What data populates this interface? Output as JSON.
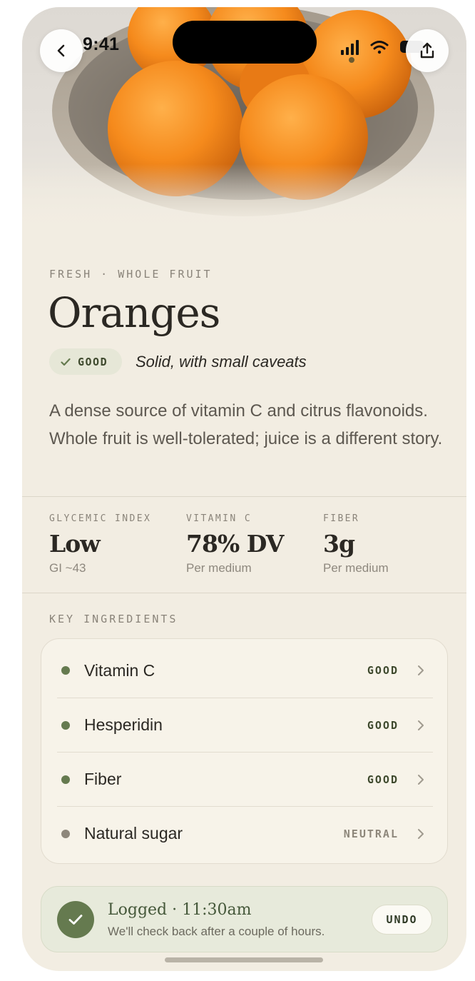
{
  "status_bar": {
    "time": "9:41"
  },
  "hero": {
    "image": "bowl of oranges photo"
  },
  "header": {
    "back_icon": "chevron-left-icon",
    "share_icon": "share-icon"
  },
  "food": {
    "eyebrow": "FRESH · WHOLE FRUIT",
    "name": "Oranges",
    "rating_label": "GOOD",
    "verdict": "Solid, with small caveats",
    "description": "A dense source of vitamin C and citrus flavonoids. Whole fruit is well-tolerated; juice is a different story."
  },
  "stats": [
    {
      "label": "GLYCEMIC INDEX",
      "value": "Low",
      "sub": "GI ~43"
    },
    {
      "label": "VITAMIN C",
      "value": "78% DV",
      "sub": "Per medium"
    },
    {
      "label": "FIBER",
      "value": "3g",
      "sub": "Per medium"
    }
  ],
  "ingredients": {
    "section_label": "KEY INGREDIENTS",
    "items": [
      {
        "name": "Vitamin C",
        "rating": "GOOD"
      },
      {
        "name": "Hesperidin",
        "rating": "GOOD"
      },
      {
        "name": "Fiber",
        "rating": "GOOD"
      },
      {
        "name": "Natural sugar",
        "rating": "NEUTRAL"
      }
    ]
  },
  "logged": {
    "title": "Logged · 11:30am",
    "subtitle": "We'll check back after a couple of hours.",
    "undo_label": "UNDO"
  },
  "colors": {
    "background": "#f2ede2",
    "good": "#657a4f",
    "neutral": "#8e877b",
    "good_text": "#3f4a2e"
  }
}
